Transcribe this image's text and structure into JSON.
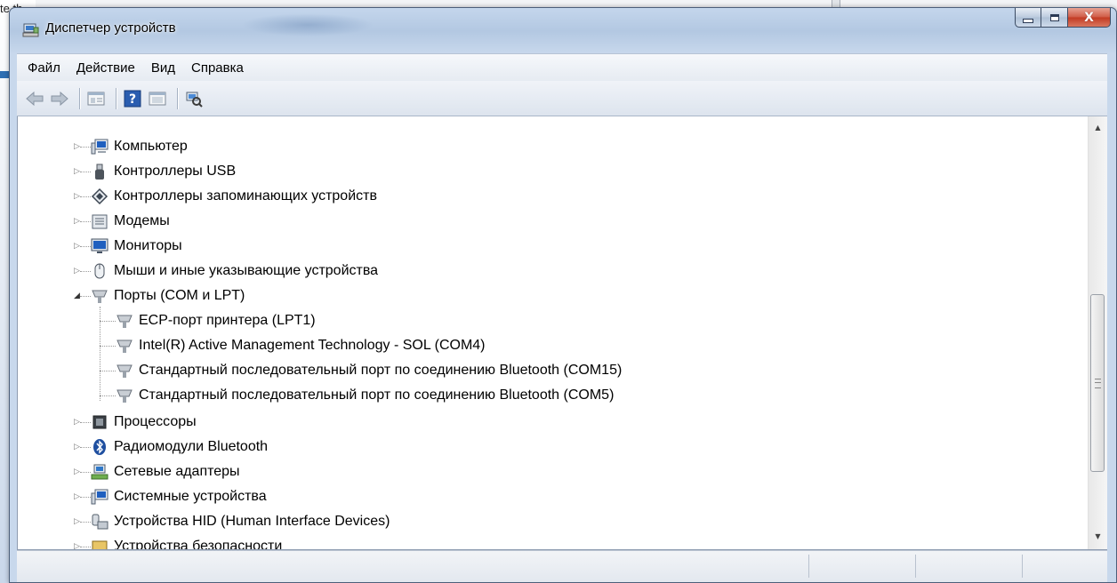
{
  "background": {
    "left_text": "te th"
  },
  "window": {
    "title": "Диспетчер устройств",
    "title_icon": "device-manager-icon",
    "caption_buttons": {
      "minimize": "minimize-icon",
      "maximize": "maximize-icon",
      "close": "X"
    }
  },
  "menubar": {
    "items": [
      "Файл",
      "Действие",
      "Вид",
      "Справка"
    ]
  },
  "toolbar": {
    "buttons": [
      "back-icon",
      "forward-icon",
      "properties-icon",
      "help-icon",
      "show-hide-icon",
      "scan-hardware-icon"
    ]
  },
  "tree": {
    "nodes": [
      {
        "label": "Компьютер",
        "icon": "computer-icon",
        "expanded": false
      },
      {
        "label": "Контроллеры USB",
        "icon": "usb-icon",
        "expanded": false
      },
      {
        "label": "Контроллеры запоминающих устройств",
        "icon": "storage-controller-icon",
        "expanded": false
      },
      {
        "label": "Модемы",
        "icon": "modem-icon",
        "expanded": false
      },
      {
        "label": "Мониторы",
        "icon": "monitor-icon",
        "expanded": false
      },
      {
        "label": "Мыши и иные указывающие устройства",
        "icon": "mouse-icon",
        "expanded": false
      },
      {
        "label": "Порты (COM и LPT)",
        "icon": "port-icon",
        "expanded": true,
        "children": [
          "ECP-порт принтера (LPT1)",
          "Intel(R) Active Management Technology - SOL (COM4)",
          "Стандартный последовательный порт по соединению Bluetooth (COM15)",
          "Стандартный последовательный порт по соединению Bluetooth (COM5)"
        ]
      },
      {
        "label": "Процессоры",
        "icon": "processor-icon",
        "expanded": false
      },
      {
        "label": "Радиомодули Bluetooth",
        "icon": "bluetooth-icon",
        "expanded": false
      },
      {
        "label": "Сетевые адаптеры",
        "icon": "network-adapter-icon",
        "expanded": false
      },
      {
        "label": "Системные устройства",
        "icon": "system-devices-icon",
        "expanded": false
      },
      {
        "label": "Устройства HID (Human Interface Devices)",
        "icon": "hid-icon",
        "expanded": false
      },
      {
        "label": "Устройства безопасности",
        "icon": "security-device-icon",
        "expanded": false
      }
    ]
  },
  "scrollbar": {
    "up_arrow": "▲",
    "down_arrow": "▼"
  },
  "colors": {
    "title_bar": "#b3c8e2",
    "close_button": "#c23a22",
    "tree_background": "#ffffff"
  }
}
